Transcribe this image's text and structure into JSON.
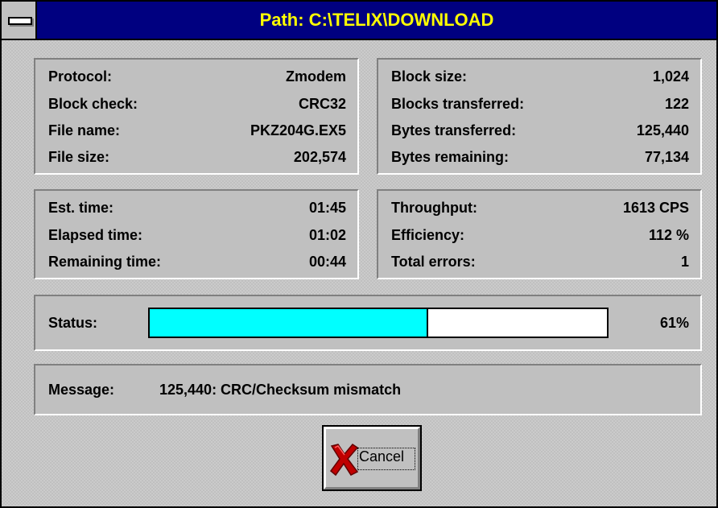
{
  "window": {
    "title": "Path: C:\\TELIX\\DOWNLOAD"
  },
  "file_info": [
    {
      "label": "Protocol:",
      "value": "Zmodem"
    },
    {
      "label": "Block check:",
      "value": "CRC32"
    },
    {
      "label": "File name:",
      "value": "PKZ204G.EX5"
    },
    {
      "label": "File size:",
      "value": "202,574"
    }
  ],
  "block_info": [
    {
      "label": "Block size:",
      "value": "1,024"
    },
    {
      "label": "Blocks transferred:",
      "value": "122"
    },
    {
      "label": "Bytes transferred:",
      "value": "125,440"
    },
    {
      "label": "Bytes remaining:",
      "value": "77,134"
    }
  ],
  "time_info": [
    {
      "label": "Est. time:",
      "value": "01:45"
    },
    {
      "label": "Elapsed time:",
      "value": "01:02"
    },
    {
      "label": "Remaining time:",
      "value": "00:44"
    }
  ],
  "rate_info": [
    {
      "label": "Throughput:",
      "value": "1613 CPS"
    },
    {
      "label": "Efficiency:",
      "value": "112 %"
    },
    {
      "label": "Total errors:",
      "value": "1"
    }
  ],
  "status": {
    "label": "Status:",
    "percent_text": "61%",
    "progress": 0.61
  },
  "message": {
    "label": "Message:",
    "text": "125,440: CRC/Checksum mismatch"
  },
  "cancel": {
    "label": "Cancel",
    "icon": "red-x-icon"
  },
  "colors": {
    "title_bg": "#000080",
    "title_text": "#ffff00",
    "progress_fill": "#00ffff",
    "face": "#c0c0c0"
  }
}
